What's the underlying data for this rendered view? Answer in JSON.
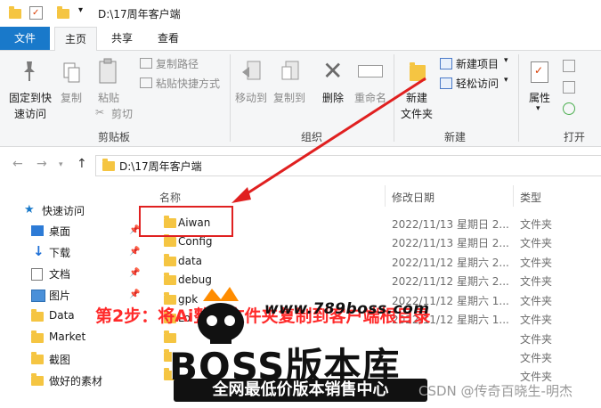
{
  "titlebar": {
    "path": "D:\\17周年客户端"
  },
  "tabs": {
    "file": "文件",
    "home": "主页",
    "share": "共享",
    "view": "查看"
  },
  "ribbon": {
    "clipboard": {
      "pin_line1": "固定到快",
      "pin_line2": "速访问",
      "copy": "复制",
      "paste": "粘贴",
      "copy_path": "复制路径",
      "paste_shortcut": "粘贴快捷方式",
      "cut": "剪切",
      "group": "剪贴板"
    },
    "organize": {
      "move_to": "移动到",
      "copy_to": "复制到",
      "delete": "删除",
      "rename": "重命名",
      "group": "组织"
    },
    "new": {
      "new_folder_line1": "新建",
      "new_folder_line2": "文件夹",
      "new_item": "新建项目",
      "easy_access": "轻松访问",
      "group": "新建"
    },
    "open": {
      "properties": "属性",
      "group": "打开"
    }
  },
  "address": {
    "path": "D:\\17周年客户端"
  },
  "columns": {
    "name": "名称",
    "date": "修改日期",
    "type": "类型"
  },
  "nav": {
    "quick_access": "快速访问",
    "items": [
      "桌面",
      "下载",
      "文档",
      "图片",
      "Data",
      "Market",
      "截图",
      "做好的素材"
    ]
  },
  "files": [
    {
      "name": "Aiwan",
      "date": "2022/11/13 星期日 2...",
      "type": "文件夹"
    },
    {
      "name": "Config",
      "date": "2022/11/13 星期日 2...",
      "type": "文件夹"
    },
    {
      "name": "data",
      "date": "2022/11/12 星期六 2...",
      "type": "文件夹"
    },
    {
      "name": "debug",
      "date": "2022/11/12 星期六 2...",
      "type": "文件夹"
    },
    {
      "name": "gpk",
      "date": "2022/11/12 星期六 1...",
      "type": "文件夹"
    },
    {
      "name": "Lo",
      "date": "2022/11/12 星期六 1...",
      "type": "文件夹"
    },
    {
      "name": "",
      "date": "",
      "type": "文件夹"
    },
    {
      "name": "",
      "date": "",
      "type": "文件夹"
    },
    {
      "name": "",
      "date": "",
      "type": "文件夹"
    }
  ],
  "overlay": {
    "step": "第2步：将Ai整个文件夹复制到客户端根目录",
    "watermark_url": "www.789boss.com",
    "watermark_big": "BOSS版本库",
    "watermark_sub": "全网最低价版本销售中心",
    "csdn": "CSDN @传奇百晓生-明杰"
  },
  "colors": {
    "file_tab": "#1979ca",
    "folder": "#f5c542",
    "highlight": "#e02020",
    "step_text": "#ff2a2a"
  }
}
